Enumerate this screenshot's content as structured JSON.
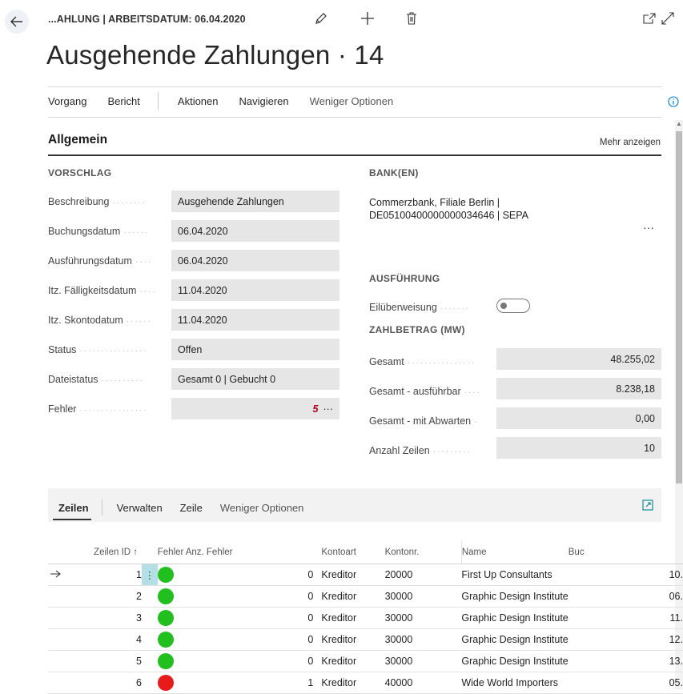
{
  "header": {
    "breadcrumb": "...AHLUNG | ARBEITSDATUM: 06.04.2020",
    "title": "Ausgehende Zahlungen · 14"
  },
  "actions": {
    "items": [
      "Vorgang",
      "Bericht",
      "Aktionen",
      "Navigieren",
      "Weniger Optionen"
    ]
  },
  "general": {
    "title": "Allgemein",
    "more_label": "Mehr anzeigen",
    "proposal_group": "VORSCHLAG",
    "fields": [
      {
        "label": "Beschreibung",
        "value": "Ausgehende Zahlungen"
      },
      {
        "label": "Buchungsdatum",
        "value": "06.04.2020"
      },
      {
        "label": "Ausführungsdatum",
        "value": "06.04.2020"
      },
      {
        "label": "Itz. Fälligkeitsdatum",
        "value": "11.04.2020"
      },
      {
        "label": "Itz. Skontodatum",
        "value": "11.04.2020"
      },
      {
        "label": "Status",
        "value": "Offen"
      },
      {
        "label": "Dateistatus",
        "value": "Gesamt 0 | Gebucht 0"
      },
      {
        "label": "Fehler",
        "value": "5"
      }
    ],
    "bank_group": "BANK(EN)",
    "bank_line1": "Commerzbank, Filiale Berlin |",
    "bank_line2": "DE05100400000000034646 | SEPA",
    "execution_group": "AUSFÜHRUNG",
    "urgent_label": "Eilüberweisung",
    "urgent_on": false,
    "amount_group": "ZAHLBETRAG (MW)",
    "amounts": [
      {
        "label": "Gesamt",
        "value": "48.255,02"
      },
      {
        "label": "Gesamt - ausführbar",
        "value": "8.238,18"
      },
      {
        "label": "Gesamt - mit Abwarten",
        "value": "0,00"
      },
      {
        "label": "Anzahl Zeilen",
        "value": "10"
      }
    ]
  },
  "lines": {
    "tabs": [
      "Zeilen",
      "Verwalten",
      "Zeile",
      "Weniger Optionen"
    ],
    "columns": [
      "Zeilen ID ↑",
      "Fehler",
      "Anz. Fehler",
      "Kontoart",
      "Kontonr.",
      "Name",
      "Buc"
    ],
    "rows": [
      {
        "id": "1",
        "status": "green",
        "errors": "0",
        "type": "Kreditor",
        "no": "20000",
        "name": "First Up Consultants",
        "date": "10."
      },
      {
        "id": "2",
        "status": "green",
        "errors": "0",
        "type": "Kreditor",
        "no": "30000",
        "name": "Graphic Design Institute",
        "date": "06."
      },
      {
        "id": "3",
        "status": "green",
        "errors": "0",
        "type": "Kreditor",
        "no": "30000",
        "name": "Graphic Design Institute",
        "date": "11."
      },
      {
        "id": "4",
        "status": "green",
        "errors": "0",
        "type": "Kreditor",
        "no": "30000",
        "name": "Graphic Design Institute",
        "date": "12."
      },
      {
        "id": "5",
        "status": "green",
        "errors": "0",
        "type": "Kreditor",
        "no": "30000",
        "name": "Graphic Design Institute",
        "date": "13."
      },
      {
        "id": "6",
        "status": "red",
        "errors": "1",
        "type": "Kreditor",
        "no": "40000",
        "name": "Wide World Importers",
        "date": "05."
      }
    ]
  },
  "colors": {
    "accent": "#008489",
    "ok": "#22c01e",
    "error": "#e81a1a",
    "selected_cell": "#b3e0e6"
  }
}
